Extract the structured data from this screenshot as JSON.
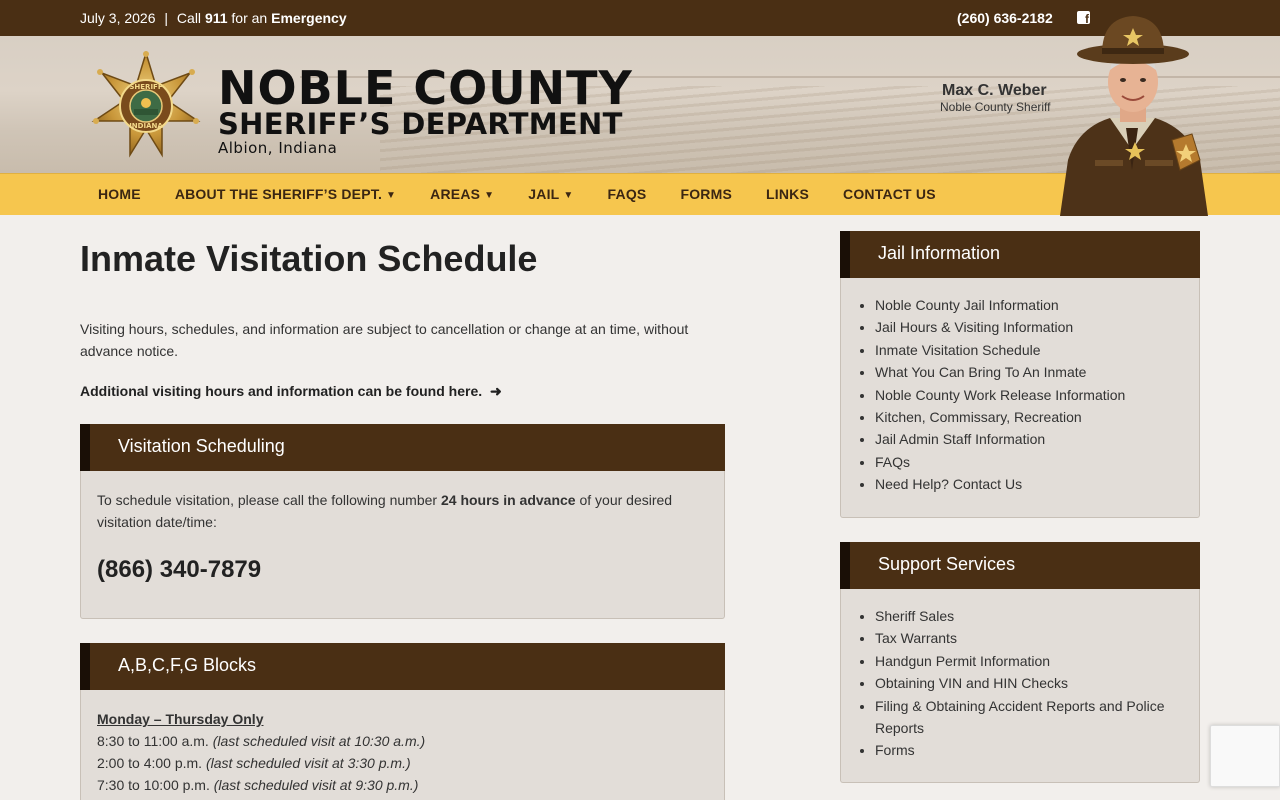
{
  "topbar": {
    "date": "July 3, 2026",
    "separator": "|",
    "call_prefix": "Call",
    "emergency_number": "911",
    "call_middle": "for an",
    "emergency_word": "Emergency",
    "phone": "(260) 636-2182",
    "facebook_icon": "facebook-icon"
  },
  "header": {
    "brand_line1": "NOBLE COUNTY",
    "brand_line2": "SHERIFF’S DEPARTMENT",
    "brand_line3": "Albion, Indiana",
    "badge_text_top": "SHERIFF",
    "badge_text_bottom": "INDIANA",
    "sheriff_name": "Max C. Weber",
    "sheriff_title": "Noble County Sheriff"
  },
  "nav": {
    "items": [
      {
        "label": "HOME",
        "dropdown": false
      },
      {
        "label": "ABOUT THE SHERIFF’S DEPT.",
        "dropdown": true
      },
      {
        "label": "AREAS",
        "dropdown": true
      },
      {
        "label": "JAIL",
        "dropdown": true
      },
      {
        "label": "FAQS",
        "dropdown": false
      },
      {
        "label": "FORMS",
        "dropdown": false
      },
      {
        "label": "LINKS",
        "dropdown": false
      },
      {
        "label": "CONTACT US",
        "dropdown": false
      }
    ]
  },
  "main": {
    "title": "Inmate Visitation Schedule",
    "intro": "Visiting hours, schedules, and information are subject to cancellation or change at an time, without advance notice.",
    "more_link": "Additional visiting hours and information can be found here.",
    "scheduling": {
      "heading": "Visitation Scheduling",
      "text_before": "To schedule visitation, please call the following number",
      "text_bold": "24 hours in advance",
      "text_after": "of your desired visitation date/time:",
      "phone": "(866) 340-7879"
    },
    "blocks": {
      "heading": "A,B,C,F,G Blocks",
      "day": "Monday – Thursday Only",
      "slots": [
        {
          "time": "8:30 to 11:00 a.m.",
          "note": "(last scheduled visit at 10:30 a.m.)"
        },
        {
          "time": "2:00 to 4:00 p.m.",
          "note": "(last scheduled visit at 3:30 p.m.)"
        },
        {
          "time": "7:30 to 10:00 p.m.",
          "note": "(last scheduled visit at 9:30 p.m.)"
        }
      ]
    }
  },
  "sidebar": {
    "jail": {
      "heading": "Jail Information",
      "items": [
        "Noble County Jail Information",
        "Jail Hours & Visiting Information",
        "Inmate Visitation Schedule",
        "What You Can Bring To An Inmate",
        "Noble County Work Release Information",
        "Kitchen, Commissary, Recreation",
        "Jail Admin Staff Information",
        "FAQs",
        "Need Help? Contact Us"
      ]
    },
    "support": {
      "heading": "Support Services",
      "items": [
        "Sheriff Sales",
        "Tax Warrants",
        "Handgun Permit Information",
        "Obtaining VIN and HIN Checks",
        "Filing & Obtaining Accident Reports and Police Reports",
        "Forms"
      ]
    }
  },
  "colors": {
    "brown": "#4a2f14",
    "nav_yellow": "#f6c64e",
    "panel_bg": "#e2ddd8",
    "page_bg": "#f2efec"
  }
}
